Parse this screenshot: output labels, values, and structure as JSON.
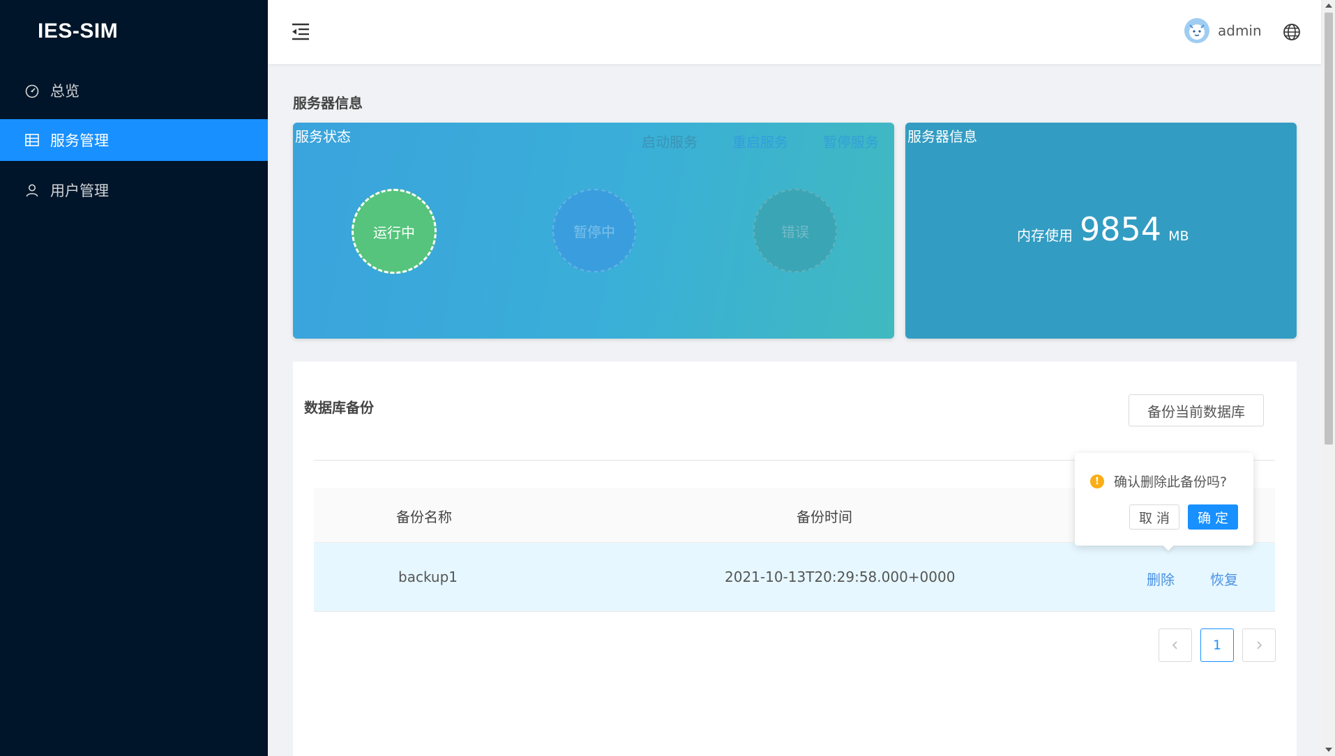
{
  "app": {
    "logo": "IES-SIM"
  },
  "sidebar": {
    "items": [
      {
        "label": "总览",
        "icon": "dashboard-icon"
      },
      {
        "label": "服务管理",
        "icon": "table-icon",
        "active": true
      },
      {
        "label": "用户管理",
        "icon": "user-icon"
      }
    ]
  },
  "header": {
    "username": "admin",
    "icons": [
      "menu-fold-icon",
      "avatar",
      "globe-icon"
    ]
  },
  "server": {
    "section_title": "服务器信息",
    "status_card": {
      "title": "服务状态",
      "actions": {
        "start": "启动服务",
        "restart": "重启服务",
        "pause": "暂停服务"
      },
      "states": {
        "running": "运行中",
        "paused": "暂停中",
        "error": "错误"
      }
    },
    "info_card": {
      "title": "服务器信息",
      "memory_label": "内存使用",
      "memory_value": "9854",
      "memory_unit": "MB"
    }
  },
  "backup": {
    "title": "数据库备份",
    "backup_button": "备份当前数据库",
    "columns": {
      "name": "备份名称",
      "time": "备份时间"
    },
    "rows": [
      {
        "name": "backup1",
        "time": "2021-10-13T20:29:58.000+0000",
        "delete": "删除",
        "restore": "恢复"
      }
    ],
    "pagination": {
      "current": "1"
    }
  },
  "popconfirm": {
    "message": "确认删除此备份吗?",
    "cancel": "取 消",
    "ok": "确 定"
  },
  "colors": {
    "primary": "#1890ff",
    "sidebar_bg": "#001529",
    "running": "#56c47c",
    "warning": "#faad14"
  }
}
